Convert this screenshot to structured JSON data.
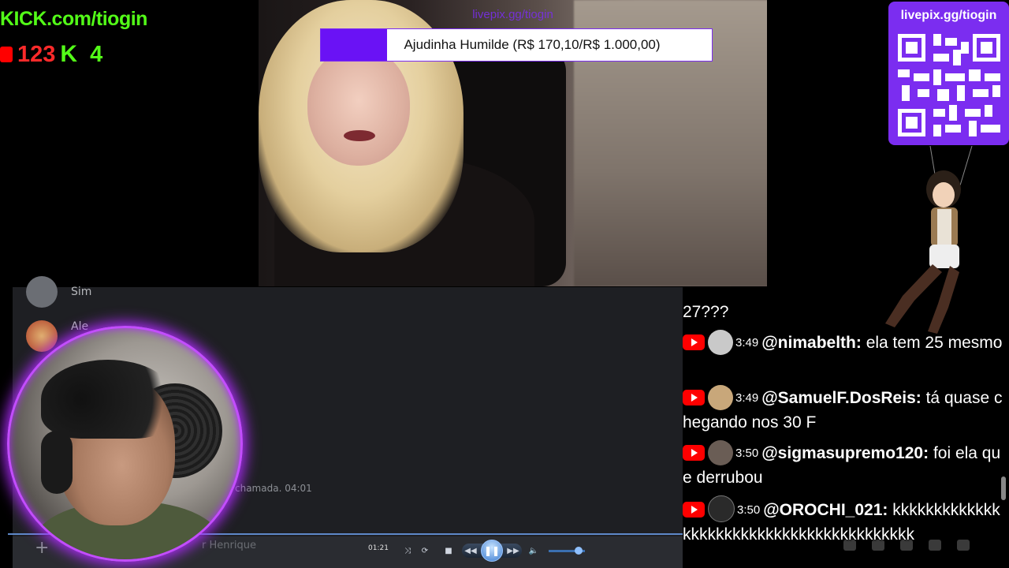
{
  "overlay": {
    "kick_url": "KICK.com/tiogin",
    "youtube_views": "123",
    "kick_letter": "K",
    "kick_viewers": "4"
  },
  "video": {
    "livepix_link": "livepix.gg/tiogin",
    "goal": {
      "text": "Ajudinha Humilde (R$ 170,10/R$ 1.000,00)",
      "progress": 0.17
    }
  },
  "qr_panel": {
    "title": "livepix.gg/tiogin",
    "accent": "#7b2df0"
  },
  "chat_app": {
    "messages": [
      {
        "author": "Sim"
      },
      {
        "author": "Ale"
      }
    ],
    "call_notice": "chamada. 04:01",
    "composer_placeholder": "r Henrique"
  },
  "media_player": {
    "time": "01:21",
    "state": "playing",
    "volume": 0.85
  },
  "youtube_chat": {
    "accent": "#ff0000",
    "partial_top": "27???",
    "messages": [
      {
        "time": "3:49",
        "user": "@nimabelth:",
        "text": "ela tem 25 mesmo",
        "avatar_color": "#c9c9c9"
      },
      {
        "time": "3:49",
        "user": "@SamuelF.DosReis:",
        "text": "tá quase chegando nos 30 F",
        "avatar_color": "#c8a77a"
      },
      {
        "time": "3:50",
        "user": "@sigmasupremo120:",
        "text": "foi ela que derrubou",
        "avatar_color": "#6a5d55"
      },
      {
        "time": "3:50",
        "user": "@OROCHI_021:",
        "text": "kkkkkkkkkkkkkkkkkkkkkkkkkkkkkkkkkkkkkkkkk",
        "avatar_color": "#2a2a2a"
      }
    ]
  }
}
